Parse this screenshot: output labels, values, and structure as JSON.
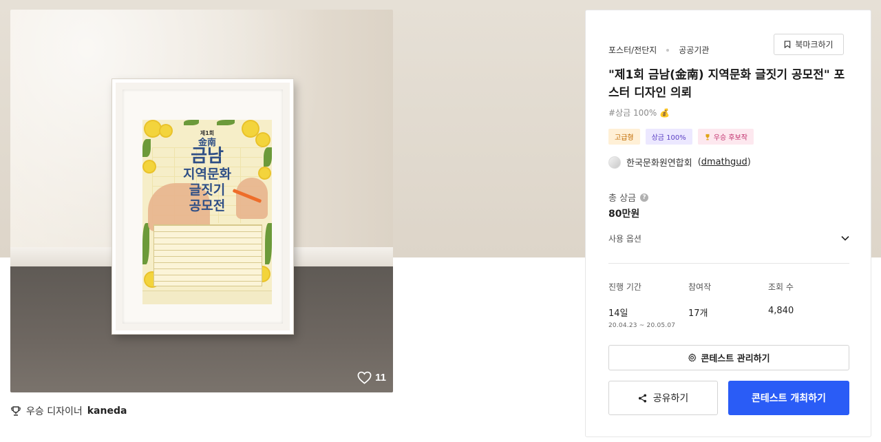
{
  "hero": {
    "likes": "11",
    "poster": {
      "line1": "제1회",
      "line2": "金南",
      "line3": "금남",
      "line4": "지역문화",
      "line5": "글짓기",
      "line6": "공모전"
    }
  },
  "winner": {
    "label": "우승 디자이너",
    "name": "kaneda"
  },
  "card": {
    "breadcrumb": [
      "포스터/전단지",
      "공공기관"
    ],
    "bookmark_label": "북마크하기",
    "title": "\"제1회 금남(金南) 지역문화 글짓기 공모전\" 포스터 디자인 의뢰",
    "hashtag": "#상금 100%",
    "hashtag_emoji": "💰",
    "tags": {
      "premium": "고급형",
      "prize": "상금 100%",
      "winner_candidate": "우승 후보작"
    },
    "host": {
      "name": "한국문화원연합회",
      "id_open": "(",
      "id": "dmathgud",
      "id_close": ")"
    },
    "prize_label": "총 상금",
    "prize_amount": "80만원",
    "usage_label": "사용 옵션",
    "stats": {
      "period_label": "진행 기간",
      "period_value": "14일",
      "period_dates": "20.04.23  ~  20.05.07",
      "entries_label": "참여작",
      "entries_value": "17개",
      "views_label": "조회 수",
      "views_value": "4,840"
    },
    "manage_label": "콘테스트 관리하기",
    "share_label": "공유하기",
    "host_contest_label": "콘테스트 개최하기"
  },
  "colors": {
    "primary": "#2a5cf6",
    "premium_tag_bg": "#fff0d6",
    "prize_tag_bg": "#ece8ff",
    "winner_tag_bg": "#fde8ef"
  }
}
